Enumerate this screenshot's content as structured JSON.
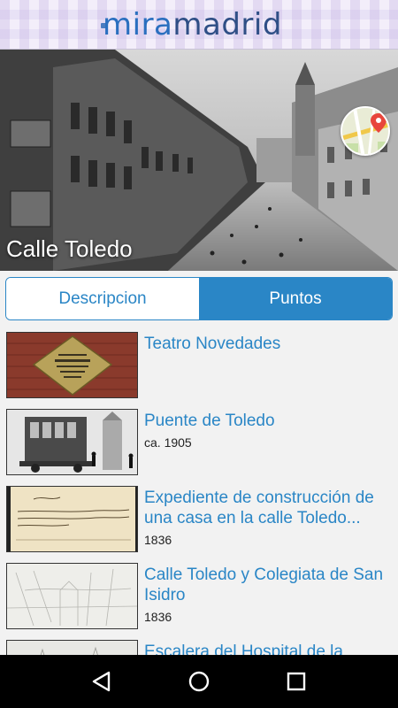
{
  "app": {
    "logo_mira": "mira",
    "logo_madrid": "madrid"
  },
  "hero": {
    "title": "Calle Toledo",
    "map_icon": "map-location-icon"
  },
  "tabs": [
    {
      "label": "Descripcion",
      "active": false
    },
    {
      "label": "Puntos",
      "active": true
    }
  ],
  "items": [
    {
      "title": "Teatro Novedades",
      "date": ""
    },
    {
      "title": "Puente de Toledo",
      "date": "ca. 1905"
    },
    {
      "title": "Expediente de construcción de una casa en la calle Toledo...",
      "date": "1836"
    },
    {
      "title": "Calle Toledo y Colegiata de San Isidro",
      "date": "1836"
    },
    {
      "title": "Escalera del Hospital de la",
      "date": ""
    }
  ],
  "navbar": {
    "back_icon": "back-triangle-icon",
    "home_icon": "home-circle-icon",
    "recents_icon": "recents-square-icon"
  },
  "colors": {
    "accent": "#2a86c6",
    "logo": "#2f4f86"
  }
}
